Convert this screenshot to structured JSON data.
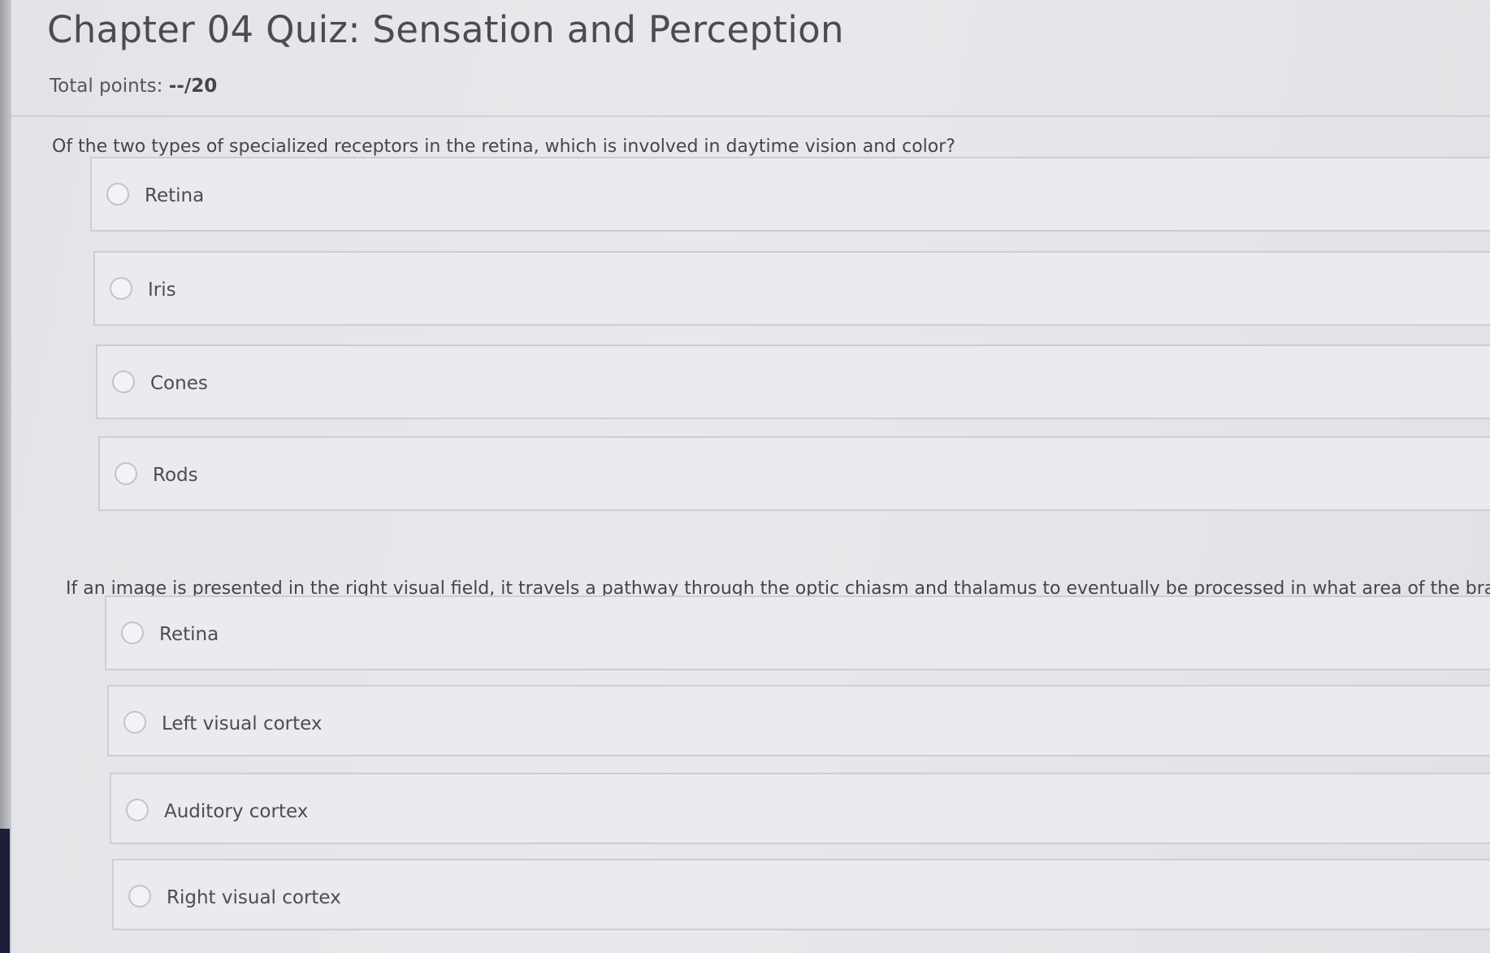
{
  "quiz": {
    "title": "Chapter 04 Quiz: Sensation and Perception",
    "total_points_label": "Total points: ",
    "total_points_value": "--/20"
  },
  "questions": [
    {
      "text": "Of the two types of specialized receptors in the retina, which is involved in daytime vision and color?",
      "options": [
        "Retina",
        "Iris",
        "Cones",
        "Rods"
      ]
    },
    {
      "text": "If an image is presented in the right visual field, it travels a pathway through the optic chiasm and thalamus to eventually be processed in what area of the brain?",
      "options": [
        "Retina",
        "Left visual cortex",
        "Auditory cortex",
        "Right visual cortex"
      ]
    }
  ],
  "colors": {
    "background": "#e6e7ea",
    "text": "#4b4c50",
    "border": "#cdced2"
  },
  "icons": {
    "radio": "radio-unchecked-icon"
  }
}
